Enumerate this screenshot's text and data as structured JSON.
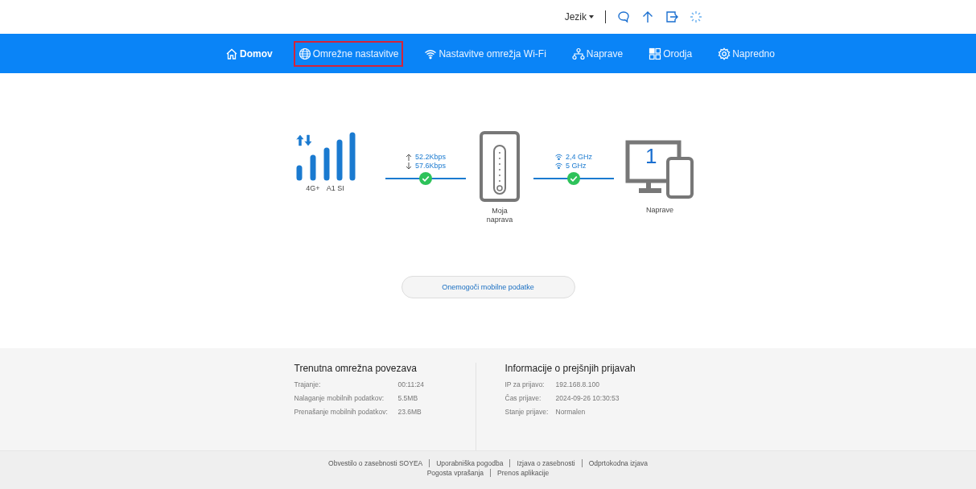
{
  "top_bar": {
    "language": "Jezik"
  },
  "nav": [
    {
      "label": "Domov",
      "kind": "home",
      "selected": true,
      "highlighted": false
    },
    {
      "label": "Omrežne nastavitve",
      "kind": "globe",
      "selected": false,
      "highlighted": true
    },
    {
      "label": "Nastavitve omrežja Wi-Fi",
      "kind": "wifi",
      "selected": false,
      "highlighted": false
    },
    {
      "label": "Naprave",
      "kind": "devices",
      "selected": false,
      "highlighted": false
    },
    {
      "label": "Orodja",
      "kind": "grid",
      "selected": false,
      "highlighted": false
    },
    {
      "label": "Napredno",
      "kind": "gear",
      "selected": false,
      "highlighted": false
    }
  ],
  "status": {
    "network": "4G+",
    "operator": "A1 SI",
    "upload": "52.2Kbps",
    "download": "57.6Kbps",
    "band_1": "2,4 GHz",
    "band_2": "5 GHz",
    "router_label": "Moja naprava",
    "device_count": "1",
    "devices_label": "Naprave"
  },
  "toggle_button": "Onemogoči mobilne podatke",
  "current_connection": {
    "title": "Trenutna omrežna povezava",
    "rows": [
      {
        "label": "Trajanje:",
        "value": "00:11:24"
      },
      {
        "label": "Nalaganje mobilnih podatkov:",
        "value": "5.5MB"
      },
      {
        "label": "Prenašanje mobilnih podatkov:",
        "value": "23.6MB"
      }
    ]
  },
  "previous_login": {
    "title": "Informacije o prejšnjih prijavah",
    "rows": [
      {
        "label": "IP za prijavo:",
        "value": "192.168.8.100"
      },
      {
        "label": "Čas prijave:",
        "value": "2024-09-26 10:30:53"
      },
      {
        "label": "Stanje prijave:",
        "value": "Normalen"
      }
    ]
  },
  "footer_links": [
    [
      "Obvestilo o zasebnosti SOYEA",
      "Uporabniška pogodba",
      "Izjava o zasebnosti",
      "Odprtokodna izjava"
    ],
    [
      "Pogosta vprašanja",
      "Prenos aplikacije"
    ]
  ]
}
